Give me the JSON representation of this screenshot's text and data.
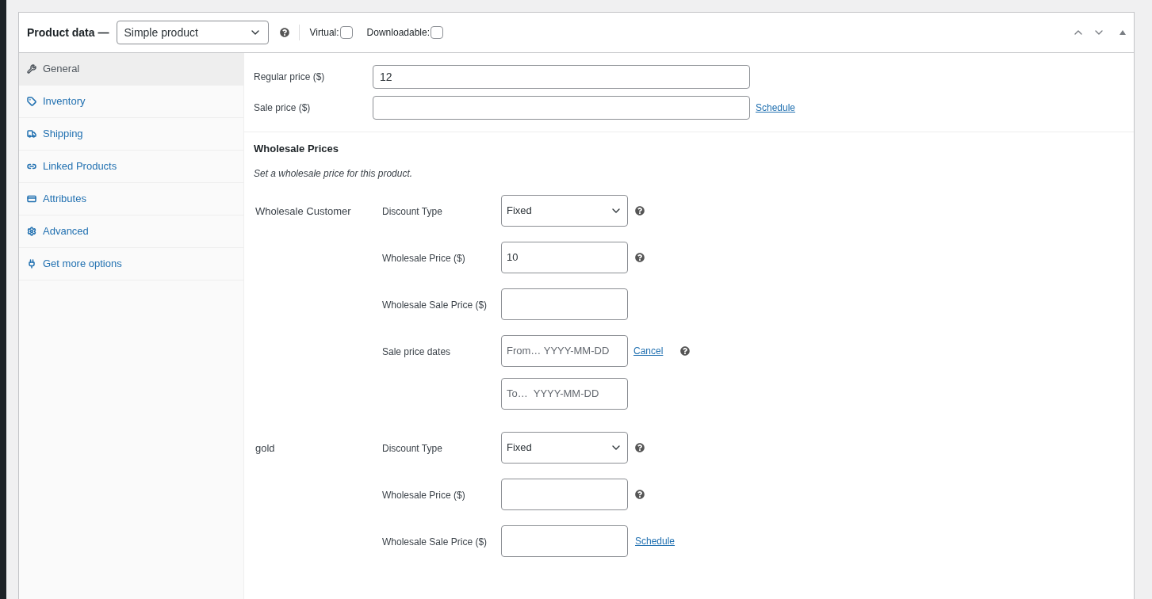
{
  "header": {
    "title": "Product data —",
    "product_type": "Simple product",
    "help": true,
    "options": [
      {
        "label": "Virtual:",
        "checked": false
      },
      {
        "label": "Downloadable:",
        "checked": false
      }
    ]
  },
  "tabs": [
    {
      "label": "General",
      "selected": true
    },
    {
      "label": "Inventory",
      "selected": false
    },
    {
      "label": "Shipping",
      "selected": false
    },
    {
      "label": "Linked Products",
      "selected": false
    },
    {
      "label": "Attributes",
      "selected": false
    },
    {
      "label": "Advanced",
      "selected": false
    },
    {
      "label": "Get more options",
      "selected": false
    }
  ],
  "pricing": [
    {
      "label": "Regular price ($)",
      "value": "12"
    },
    {
      "label": "Sale price ($)",
      "link": "Schedule"
    }
  ],
  "wholesale": {
    "title": "Wholesale Prices",
    "description": "Set a wholesale price for this product.",
    "roles": [
      {
        "name": "Wholesale Customer",
        "fields": [
          {
            "kind": "select",
            "label": "Discount Type",
            "value": "Fixed",
            "help": true
          },
          {
            "kind": "text",
            "label": "Wholesale Price ($)",
            "value": "10",
            "help": true
          },
          {
            "kind": "text",
            "label": "Wholesale Sale Price ($)",
            "help": false
          },
          {
            "kind": "dates",
            "label": "Sale price dates",
            "from_placeholder": "From… YYYY-MM-DD",
            "to_placeholder": "To…  YYYY-MM-DD",
            "link": "Cancel",
            "help": true
          }
        ]
      },
      {
        "name": "gold",
        "fields": [
          {
            "kind": "select",
            "label": "Discount Type",
            "value": "Fixed",
            "help": true
          },
          {
            "kind": "text",
            "label": "Wholesale Price ($)",
            "help": true
          },
          {
            "kind": "text",
            "label": "Wholesale Sale Price ($)",
            "help": false,
            "link": "Schedule"
          }
        ]
      }
    ]
  }
}
